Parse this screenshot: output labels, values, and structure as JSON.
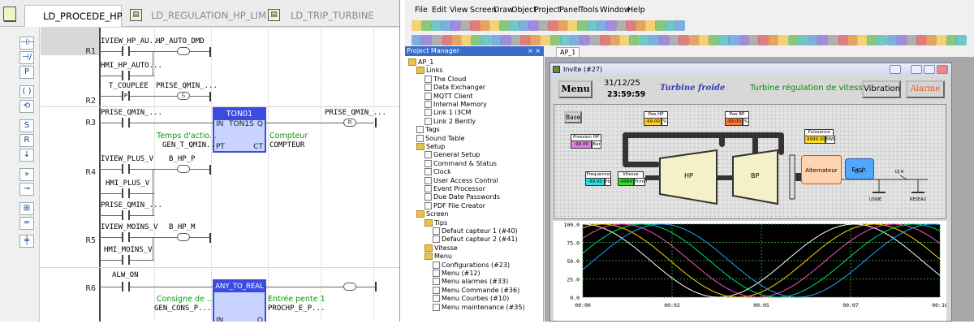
{
  "ladder": {
    "tabs": [
      "LD_PROCEDE_HP",
      "LD_REGULATION_HP_LIM",
      "LD_TRIP_TURBINE"
    ],
    "rows": [
      "R1",
      "R2",
      "R3",
      "R4",
      "R5",
      "R6"
    ],
    "r1": {
      "c1": "IVIEW_HP_AU...",
      "c2": "HP_AUTO_DMD",
      "c3": "HMI_HP_AUTO..."
    },
    "r2": {
      "c1": "T_COUPLEE",
      "c2": "PRISE_QMIN_...",
      "p": "P",
      "s": "S"
    },
    "r3": {
      "c1": "PRISE_QMIN_...",
      "blk_title": "TON01",
      "blk_in": "IN",
      "blk_ton": "TON1S",
      "blk_q": "Q",
      "blk_pt": "PT",
      "blk_ct": "CT",
      "coil": "PRISE_QMIN_...",
      "r": "R",
      "pt_label": "Temps d'actio...",
      "pt_var": "GEN_T_QMIN...",
      "ct_label": "Compteur",
      "ct_var": "COMPTEUR"
    },
    "r4": {
      "c1": "IVIEW_PLUS_V",
      "c2": "B_HP_P",
      "c3": "HMI_PLUS_V",
      "c4": "PRISE_QMIN_..."
    },
    "r5": {
      "c1": "IVIEW_MOINS_V",
      "c2": "B_HP_M",
      "c3": "HMI_MOINS_V"
    },
    "r6": {
      "c1": "ALW_ON",
      "blk_title": "ANY_TO_REAL",
      "in_label": "Consigne de ...",
      "in_var": "GEN_CONS_P...",
      "in": "IN",
      "q": "Q",
      "out_label": "Entrée pente 1",
      "out_var": "PROCHP_E_P..."
    }
  },
  "ide": {
    "menu": [
      "File",
      "Edit",
      "View",
      "Screen",
      "Draw",
      "Object",
      "Project",
      "Panel",
      "Tools",
      "Window",
      "Help"
    ],
    "pm_title": "Project Manager",
    "pm_close": "× ×",
    "tab": "AP_1",
    "tree": [
      {
        "t": "AP_1",
        "lvl": 0,
        "kind": "root"
      },
      {
        "t": "Links",
        "lvl": 1,
        "kind": "folder"
      },
      {
        "t": "The Cloud",
        "lvl": 2,
        "kind": "page"
      },
      {
        "t": "Data Exchanger",
        "lvl": 2,
        "kind": "page"
      },
      {
        "t": "MQTT Client",
        "lvl": 2,
        "kind": "page"
      },
      {
        "t": "Internal Memory",
        "lvl": 2,
        "kind": "page"
      },
      {
        "t": "Link 1 i3CM",
        "lvl": 2,
        "kind": "page"
      },
      {
        "t": "Link 2 Bently",
        "lvl": 2,
        "kind": "page"
      },
      {
        "t": "Tags",
        "lvl": 1,
        "kind": "page"
      },
      {
        "t": "Sound Table",
        "lvl": 1,
        "kind": "page"
      },
      {
        "t": "Setup",
        "lvl": 1,
        "kind": "folder"
      },
      {
        "t": "General Setup",
        "lvl": 2,
        "kind": "page"
      },
      {
        "t": "Command & Status",
        "lvl": 2,
        "kind": "page"
      },
      {
        "t": "Clock",
        "lvl": 2,
        "kind": "page"
      },
      {
        "t": "User Access Control",
        "lvl": 2,
        "kind": "page"
      },
      {
        "t": "Event Processor",
        "lvl": 2,
        "kind": "page"
      },
      {
        "t": "Due Date Passwords",
        "lvl": 2,
        "kind": "page"
      },
      {
        "t": "PDF File Creator",
        "lvl": 2,
        "kind": "page"
      },
      {
        "t": "Screen",
        "lvl": 1,
        "kind": "folder"
      },
      {
        "t": "Tips",
        "lvl": 2,
        "kind": "folder"
      },
      {
        "t": "Defaut capteur 1 (#40)",
        "lvl": 3,
        "kind": "page"
      },
      {
        "t": "Defaut capteur 2  (#41)",
        "lvl": 3,
        "kind": "page"
      },
      {
        "t": "Vitesse",
        "lvl": 2,
        "kind": "folder"
      },
      {
        "t": "Menu",
        "lvl": 2,
        "kind": "folder"
      },
      {
        "t": "Configurations (#23)",
        "lvl": 3,
        "kind": "page"
      },
      {
        "t": "Menu (#12)",
        "lvl": 3,
        "kind": "page"
      },
      {
        "t": "Menu alarmes (#33)",
        "lvl": 3,
        "kind": "page"
      },
      {
        "t": "Menu Commande (#36)",
        "lvl": 3,
        "kind": "page"
      },
      {
        "t": "Menu Courbes (#10)",
        "lvl": 3,
        "kind": "page"
      },
      {
        "t": "Menu maintenance (#35)",
        "lvl": 3,
        "kind": "page"
      }
    ],
    "window": {
      "title": "Invite (#27)",
      "menu_btn": "Menu",
      "date": "31/12/25",
      "time": "23:59:59",
      "state": "Turbine froide",
      "subtitle": "Turbine régulation de vitesse",
      "vibration": "Vibration",
      "alarme": "Alarme",
      "base": "Base",
      "poe_hp": "Poe HP",
      "poe_bp": "Poe BP",
      "pct": "%",
      "pression_hp": "Pression HP",
      "bar": "Bar",
      "frequence": "Frequence",
      "hz": "Hz",
      "vitesse": "Vitesse",
      "trmn": "Tr/mn",
      "puissance": "Puissance",
      "mw": "MW",
      "hp": "HP",
      "bp": "BP",
      "alternateur": "Alternateur",
      "excit": "Excit.",
      "dja": "DJ A",
      "djr": "DJ R",
      "usine": "USINE",
      "reseau": "RESEAU",
      "v_poe_hp": "-99.00",
      "v_poe_bp": "-99.00",
      "v_pression": "-99.00",
      "v_freq": "-99.00",
      "v_vitesse": "-9999",
      "v_puissance": "-9999.00"
    }
  },
  "chart_data": {
    "type": "line",
    "title": "",
    "xlabel": "",
    "ylabel": "",
    "ylim": [
      0,
      100
    ],
    "yticks": [
      "100.0",
      "75.0",
      "50.0",
      "25.0",
      "0.0"
    ],
    "xticks": [
      "00:00",
      "00:02",
      "00:05",
      "00:07",
      "00:10"
    ],
    "grid": true,
    "background": "#000000",
    "series": [
      {
        "color": "#ffffff",
        "phase": 0.0,
        "period": 7.6
      },
      {
        "color": "#ffd400",
        "phase": 0.55,
        "period": 7.6
      },
      {
        "color": "#ff50c0",
        "phase": 1.1,
        "period": 7.6
      },
      {
        "color": "#00e070",
        "phase": 1.65,
        "period": 7.6
      },
      {
        "color": "#2aa0ff",
        "phase": 2.2,
        "period": 7.6
      }
    ]
  }
}
